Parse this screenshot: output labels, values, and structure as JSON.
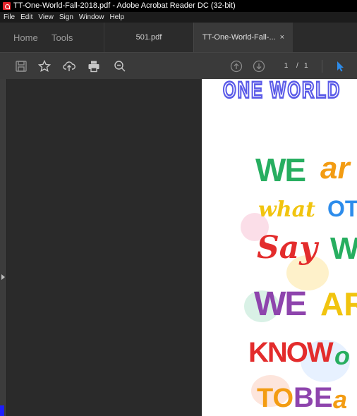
{
  "window": {
    "title": "TT-One-World-Fall-2018.pdf - Adobe Acrobat Reader DC (32-bit)"
  },
  "menu": [
    "File",
    "Edit",
    "View",
    "Sign",
    "Window",
    "Help"
  ],
  "tabs": {
    "home": "Home",
    "tools": "Tools",
    "doc1": "501.pdf",
    "doc2": "TT-One-World-Fall-...",
    "doc2_close": "×"
  },
  "toolbar": {
    "icons": [
      "save-icon",
      "star-icon",
      "upload-cloud-icon",
      "print-icon",
      "zoom-out-icon",
      "page-up-icon",
      "page-down-icon",
      "select-cursor-icon"
    ],
    "current_page": "1",
    "page_separator": "/",
    "total_pages": "1"
  },
  "document": {
    "header_text": "ONE WORLD",
    "poster_lines": [
      "WE",
      "ar",
      "what",
      "OT",
      "Say",
      "W",
      "WE",
      "AR",
      "KNOW",
      "o",
      "TO",
      "BE",
      "a"
    ]
  },
  "colors": {
    "title_bg": "#000000",
    "menu_bg": "#1c1c1c",
    "tab_bg": "#2b2b2b",
    "active_tab_bg": "#3a3a3a",
    "toolbar_bg": "#3a3a3a",
    "viewer_bg": "#2a2a2a",
    "accent_blue": "#2d8ceb"
  }
}
